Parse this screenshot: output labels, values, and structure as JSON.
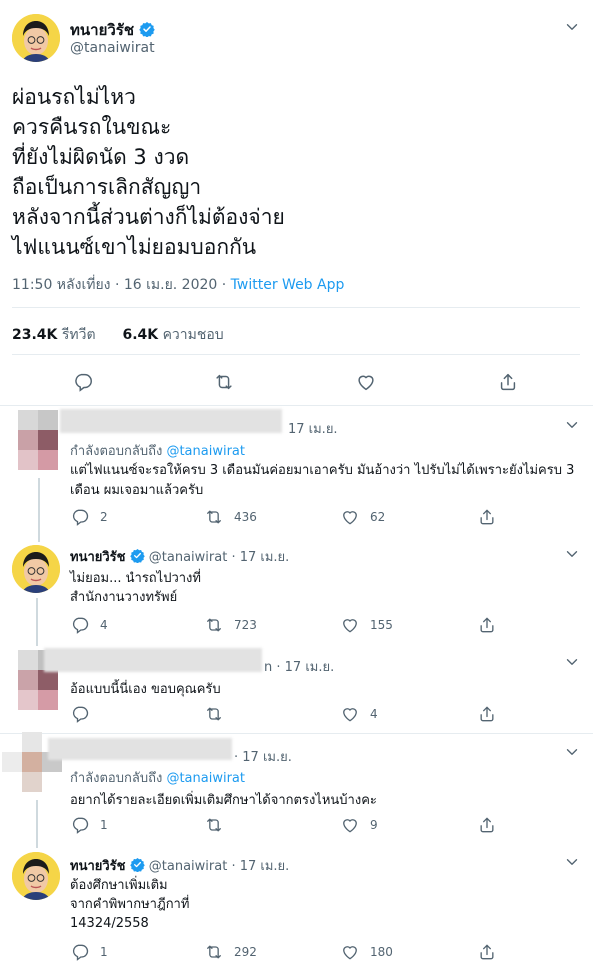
{
  "main_tweet": {
    "display_name": "ทนายวิรัช",
    "handle": "@tanaiwirat",
    "lines": [
      "ผ่อนรถไม่ไหว",
      "ควรคืนรถในขณะ",
      "ที่ยังไม่ผิดนัด 3 งวด",
      "ถือเป็นการเลิกสัญญา",
      "หลังจากนี้ส่วนต่างก็ไม่ต้องจ่าย",
      "ไฟแนนซ์เขาไม่ยอมบอกกัน"
    ],
    "time": "11:50 หลังเที่ยง · 16 เม.ย. 2020 ·",
    "source": "Twitter Web App",
    "retweets_count": "23.4K",
    "retweets_label": "รีทวีต",
    "likes_count": "6.4K",
    "likes_label": "ความชอบ"
  },
  "replies": [
    {
      "date": "17 เม.ย.",
      "replying_label": "กำลังตอบกลับถึง",
      "replying_to": "@tanaiwirat",
      "text": "แต่ไฟแนนซ์จะรอให้ครบ 3 เดือนมันค่อยมาเอาครับ มันอ้างว่า ไปรับไม่ได้เพราะยังไม่ครบ 3 เดือน ผมเจอมาแล้วครับ",
      "replies": "2",
      "retweets": "436",
      "likes": "62"
    },
    {
      "display_name": "ทนายวิรัช",
      "handle": "@tanaiwirat",
      "date": "· 17 เม.ย.",
      "text_lines": [
        "ไม่ยอม... นำรถไปวางที่",
        "สำนักงานวางทรัพย์"
      ],
      "replies": "4",
      "retweets": "723",
      "likes": "155"
    },
    {
      "handle_tail": "n",
      "date": "· 17 เม.ย.",
      "text": "อ้อแบบนี้นี่เอง ขอบคุณครับ",
      "replies": "",
      "retweets": "",
      "likes": "4"
    },
    {
      "date": "· 17 เม.ย.",
      "replying_label": "กำลังตอบกลับถึง",
      "replying_to": "@tanaiwirat",
      "text": "อยากได้รายละเอียดเพิ่มเติมศึกษาได้จากตรงไหนบ้างคะ",
      "replies": "1",
      "retweets": "",
      "likes": "9"
    },
    {
      "display_name": "ทนายวิรัช",
      "handle": "@tanaiwirat",
      "date": "· 17 เม.ย.",
      "text_lines": [
        "ต้องศึกษาเพิ่มเติม",
        "จากคำพิพากษาฎีกาที่",
        "14324/2558"
      ],
      "replies": "1",
      "retweets": "292",
      "likes": "180"
    }
  ],
  "colors": {
    "accent": "#1d9bf0",
    "text": "#0f1419",
    "muted": "#536471",
    "divider": "#e6ecf0"
  }
}
